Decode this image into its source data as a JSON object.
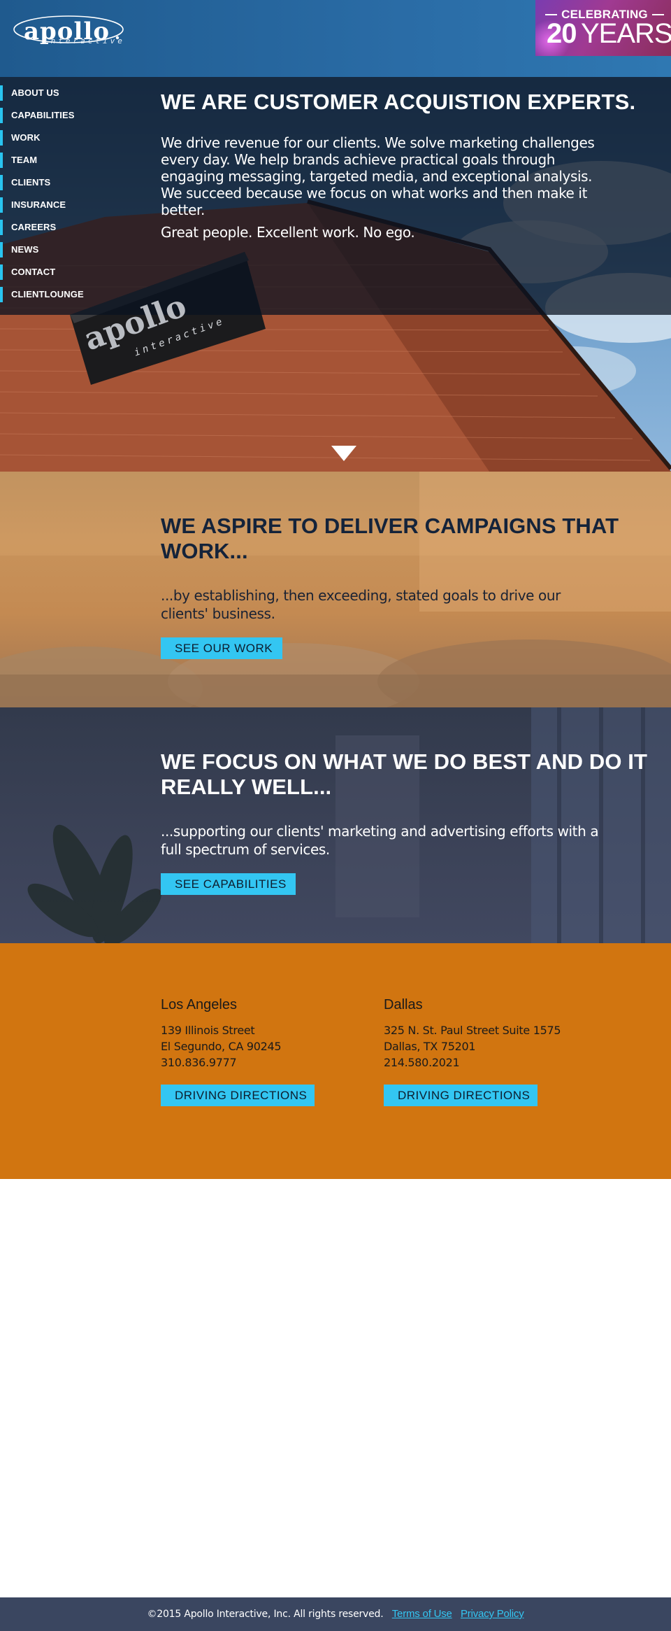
{
  "brand": {
    "logo_text": "apollo",
    "logo_sub": "interactive",
    "badge_top": "CELEBRATING",
    "badge_number": "20",
    "badge_word": "YEARS"
  },
  "nav": {
    "items": [
      {
        "label": "ABOUT US"
      },
      {
        "label": "CAPABILITIES"
      },
      {
        "label": "WORK"
      },
      {
        "label": "TEAM"
      },
      {
        "label": "CLIENTS"
      },
      {
        "label": "INSURANCE"
      },
      {
        "label": "CAREERS"
      },
      {
        "label": "NEWS"
      },
      {
        "label": "CONTACT"
      },
      {
        "label": "CLIENTLOUNGE"
      }
    ]
  },
  "hero": {
    "title": "WE ARE CUSTOMER ACQUISTION EXPERTS.",
    "text": "We drive revenue for our clients. We solve marketing challenges every day. We help brands achieve practical goals through engaging messaging, targeted media, and exceptional analysis. We succeed because we focus on what works and then make it better.",
    "tagline": "Great people. Excellent work. No ego.",
    "sign_text": "apollo",
    "sign_sub": "interactive"
  },
  "work": {
    "title": "WE ASPIRE TO DELIVER CAMPAIGNS THAT WORK...",
    "text": "...by establishing, then exceeding, stated goals to drive our clients' business.",
    "button": "SEE OUR WORK"
  },
  "capabilities": {
    "title": "WE FOCUS ON WHAT WE DO BEST AND DO IT REALLY WELL...",
    "text": "...supporting our clients' marketing and advertising efforts with a full spectrum of services.",
    "button": "SEE CAPABILITIES"
  },
  "locations": [
    {
      "city": "Los Angeles",
      "street": "139 Illinois Street",
      "citystate": "El Segundo, CA 90245",
      "phone": "310.836.9777",
      "button": "DRIVING DIRECTIONS"
    },
    {
      "city": "Dallas",
      "street": "325 N. St. Paul Street Suite 1575",
      "citystate": "Dallas, TX 75201",
      "phone": "214.580.2021",
      "button": "DRIVING DIRECTIONS"
    }
  ],
  "footer": {
    "copyright": "©2015 Apollo Interactive, Inc. All rights reserved.",
    "terms": "Terms of Use",
    "privacy": "Privacy Policy"
  },
  "colors": {
    "accent": "#33c6f2",
    "header_blue": "#2a6ca6",
    "badge_purple": "#a03a92",
    "locations_orange": "#d17510",
    "footer_navy": "#3a4660"
  },
  "icons": {
    "scroll": "down-triangle-icon"
  }
}
